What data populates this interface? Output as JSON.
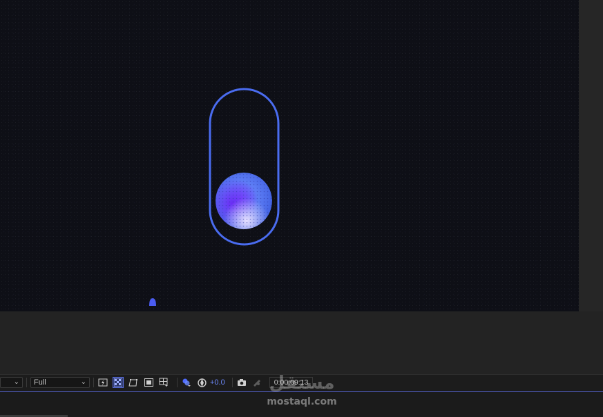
{
  "toolbar": {
    "magnification_value": "",
    "resolution_value": "Full",
    "exposure_value": "+0.0",
    "timecode": "0:00:09:13"
  },
  "icons": {
    "fast_previews": "lightning-icon",
    "transparency_grid": "checkerboard-icon",
    "mask_visibility": "mask-path-icon",
    "region_of_interest": "region-icon",
    "guides": "grid-guides-icon",
    "color_channels": "color-channels-icon",
    "reset_exposure": "exposure-icon",
    "snapshot": "camera-icon",
    "show_snapshot": "show-snapshot-icon"
  },
  "watermark": {
    "arabic": "مستقل",
    "latin": "mostaql.com"
  },
  "colors": {
    "accent": "#5b6fe0",
    "capsule_stroke": "#4a6cf0",
    "orb_purple": "#6a3af0",
    "orb_blue": "#5d7df5",
    "background_dark": "#0e0f16",
    "panel": "#232323"
  }
}
